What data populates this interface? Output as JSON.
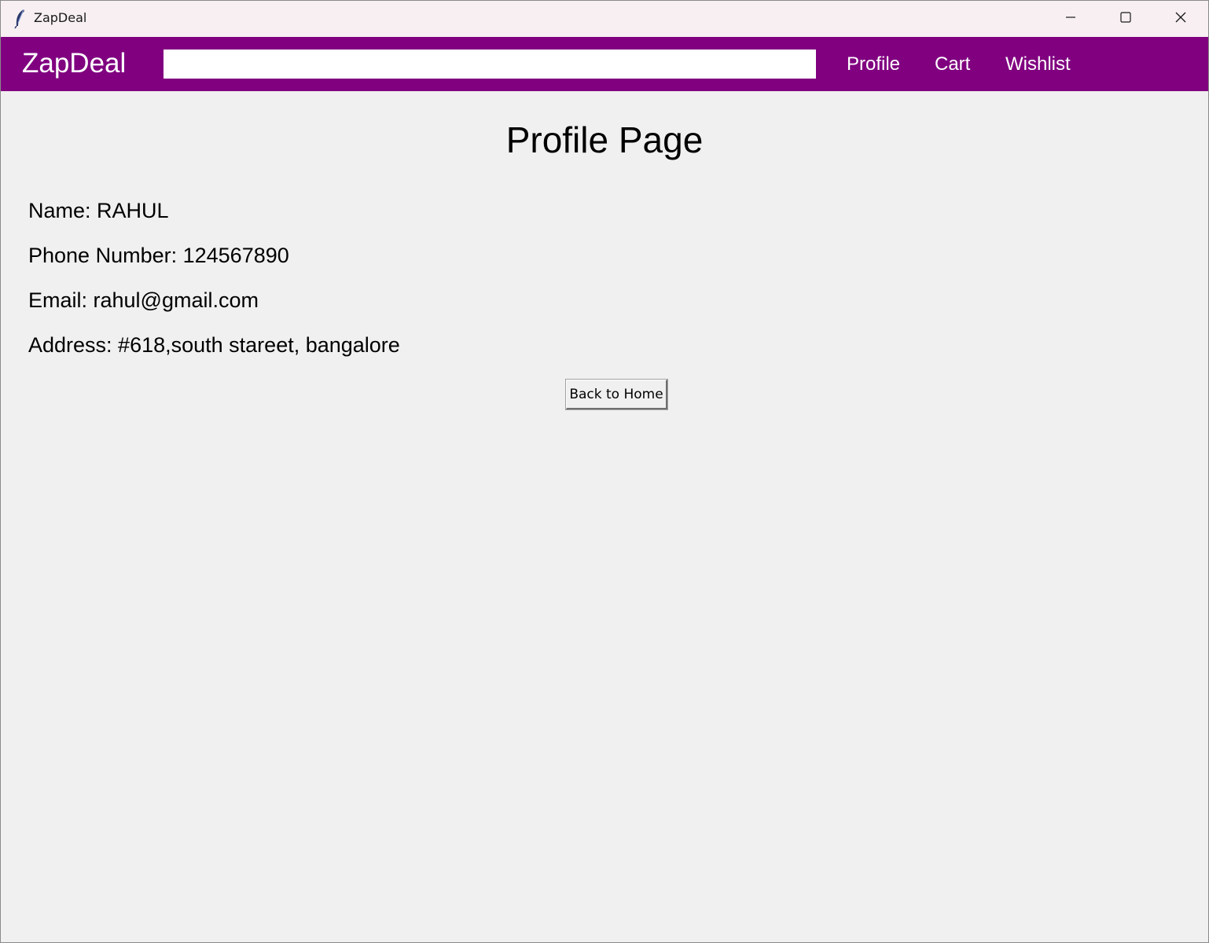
{
  "window": {
    "title": "ZapDeal",
    "title_icon": "feather-icon",
    "controls": {
      "minimize_icon": "minimize-icon",
      "maximize_icon": "maximize-icon",
      "close_icon": "close-icon"
    }
  },
  "navbar": {
    "brand": "ZapDeal",
    "background_color": "#800080",
    "search": {
      "value": "",
      "placeholder": ""
    },
    "links": {
      "profile": "Profile",
      "cart": "Cart",
      "wishlist": "Wishlist"
    }
  },
  "main": {
    "title": "Profile Page",
    "name_line": "Name: RAHUL",
    "phone_line": "Phone Number: 124567890",
    "email_line": "Email: rahul@gmail.com",
    "address_line": "Address: #618,south stareet, bangalore",
    "back_button_label": "Back to Home"
  }
}
